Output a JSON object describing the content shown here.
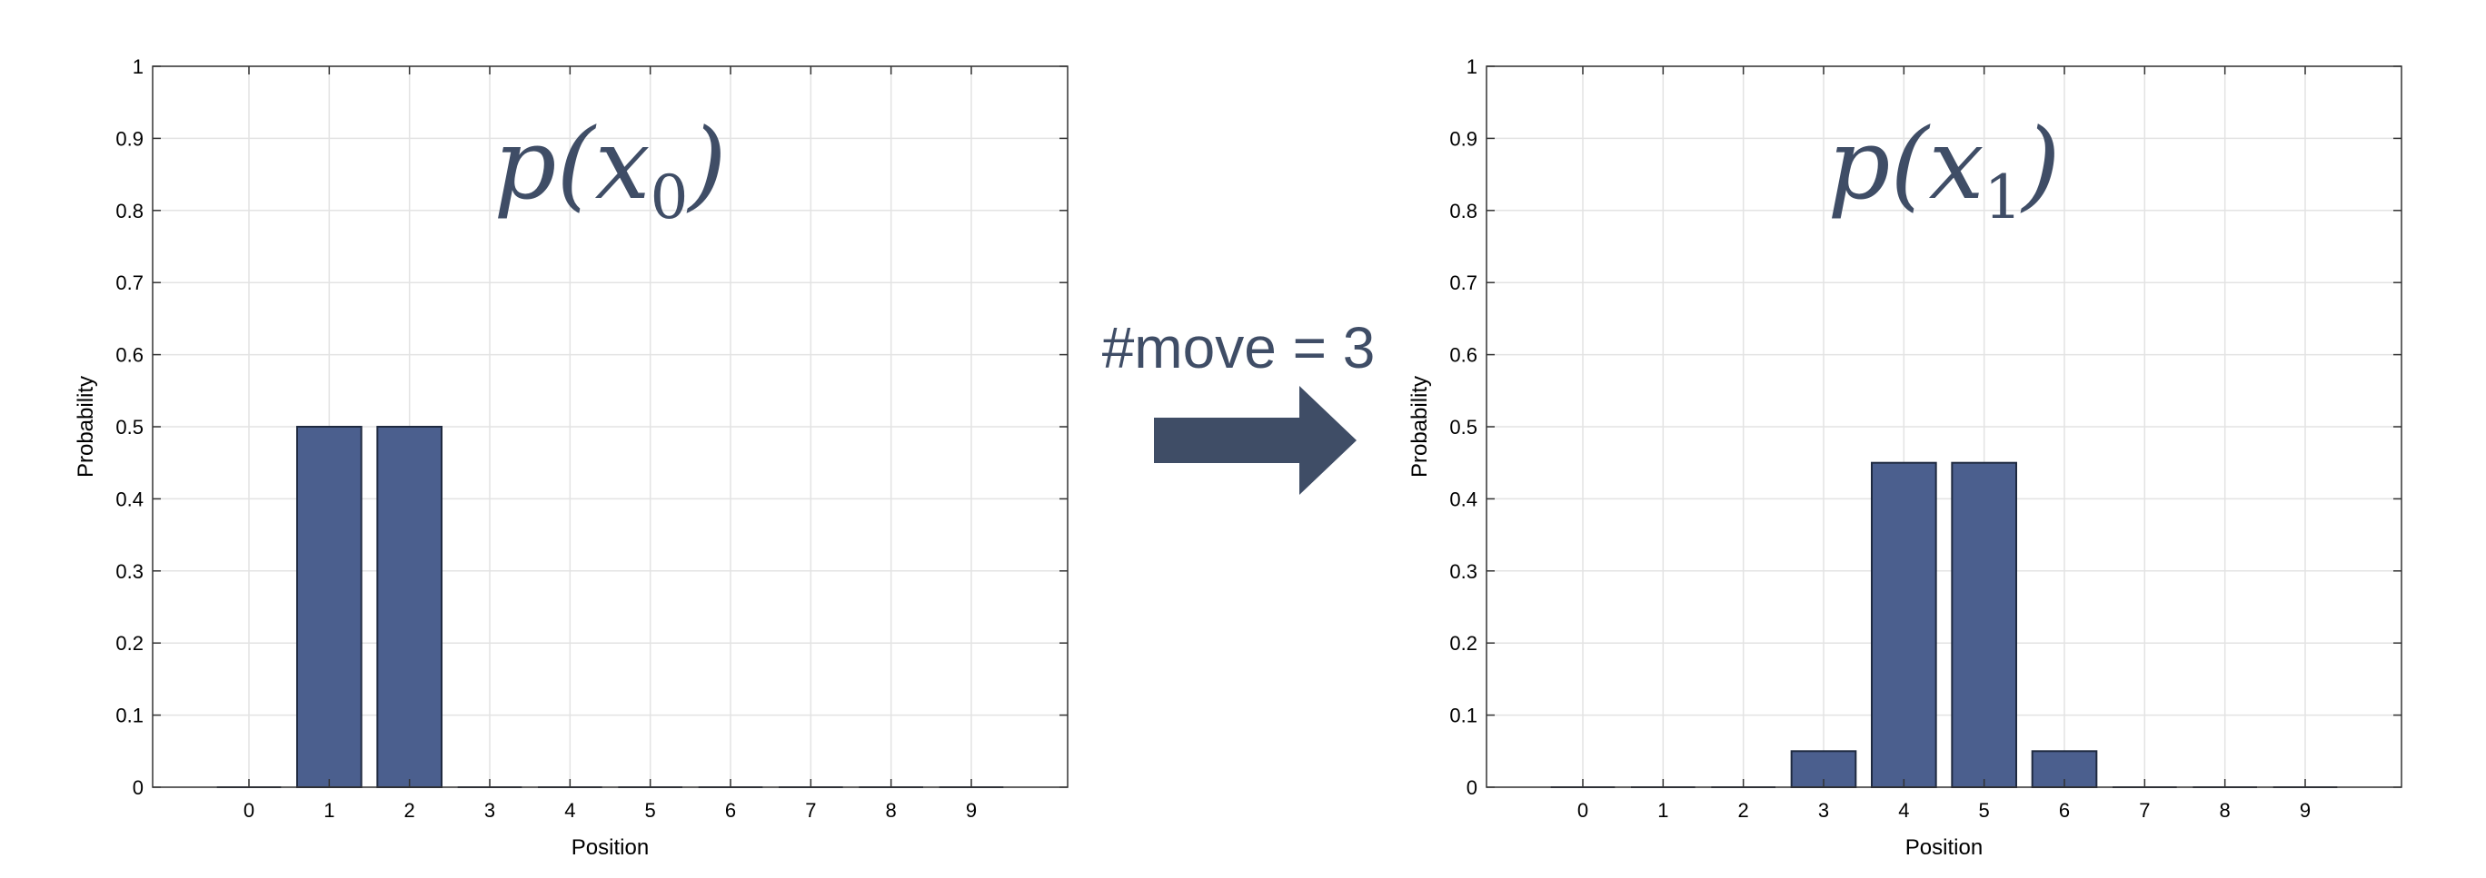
{
  "annotation": {
    "text": "#move = 3",
    "arrow_icon": "right-arrow-icon",
    "color": "#3f4d66"
  },
  "colors": {
    "bar_fill": "#4b5f8e",
    "bar_stroke": "#1f2a40",
    "grid": "#e3e3e3",
    "axis": "#333333",
    "title": "#3f4d66"
  },
  "chart_data": [
    {
      "type": "bar",
      "title": "p(x0)",
      "title_base": "p(x",
      "title_sub": "0",
      "title_close": ")",
      "xlabel": "Position",
      "ylabel": "Probability",
      "categories": [
        "0",
        "1",
        "2",
        "3",
        "4",
        "5",
        "6",
        "7",
        "8",
        "9"
      ],
      "values": [
        0,
        0.5,
        0.5,
        0,
        0,
        0,
        0,
        0,
        0,
        0
      ],
      "xlim": [
        -1.2,
        10.2
      ],
      "ylim": [
        0,
        1
      ],
      "yticks": [
        "0",
        "0.1",
        "0.2",
        "0.3",
        "0.4",
        "0.5",
        "0.6",
        "0.7",
        "0.8",
        "0.9",
        "1"
      ],
      "grid": true
    },
    {
      "type": "bar",
      "title": "p(x1)",
      "title_base": "p(x",
      "title_sub": "1",
      "title_close": ")",
      "xlabel": "Position",
      "ylabel": "Probability",
      "categories": [
        "0",
        "1",
        "2",
        "3",
        "4",
        "5",
        "6",
        "7",
        "8",
        "9"
      ],
      "values": [
        0,
        0,
        0,
        0.05,
        0.45,
        0.45,
        0.05,
        0,
        0,
        0
      ],
      "xlim": [
        -1.2,
        10.2
      ],
      "ylim": [
        0,
        1
      ],
      "yticks": [
        "0",
        "0.1",
        "0.2",
        "0.3",
        "0.4",
        "0.5",
        "0.6",
        "0.7",
        "0.8",
        "0.9",
        "1"
      ],
      "grid": true
    }
  ]
}
